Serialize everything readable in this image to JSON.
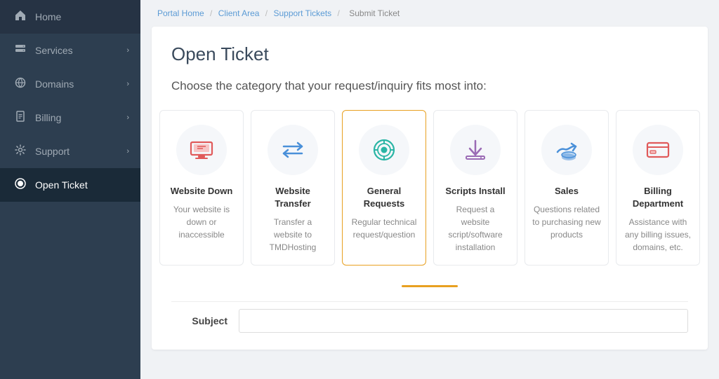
{
  "sidebar": {
    "items": [
      {
        "id": "home",
        "label": "Home",
        "icon": "home",
        "arrow": false,
        "active": false
      },
      {
        "id": "services",
        "label": "Services",
        "icon": "server",
        "arrow": true,
        "active": false
      },
      {
        "id": "domains",
        "label": "Domains",
        "icon": "globe",
        "arrow": true,
        "active": false
      },
      {
        "id": "billing",
        "label": "Billing",
        "icon": "file",
        "arrow": true,
        "active": false
      },
      {
        "id": "support",
        "label": "Support",
        "icon": "gear",
        "arrow": true,
        "active": false
      },
      {
        "id": "open-ticket",
        "label": "Open Ticket",
        "icon": "ticket",
        "arrow": false,
        "active": true
      }
    ]
  },
  "breadcrumb": {
    "items": [
      {
        "label": "Portal Home",
        "link": true
      },
      {
        "label": "Client Area",
        "link": true
      },
      {
        "label": "Support Tickets",
        "link": true
      },
      {
        "label": "Submit Ticket",
        "link": false
      }
    ]
  },
  "page": {
    "title": "Open Ticket",
    "subtitle": "Choose the category that your request/inquiry fits most into:"
  },
  "categories": [
    {
      "id": "website-down",
      "title": "Website Down",
      "description": "Your website is down or inaccessible",
      "color": "#e05a5a",
      "selected": false
    },
    {
      "id": "website-transfer",
      "title": "Website Transfer",
      "description": "Transfer a website to TMDHosting",
      "color": "#4a90d9",
      "selected": false
    },
    {
      "id": "general-requests",
      "title": "General Requests",
      "description": "Regular technical request/question",
      "color": "#2ab5a5",
      "selected": true
    },
    {
      "id": "scripts-install",
      "title": "Scripts Install",
      "description": "Request a website script/software installation",
      "color": "#9b6bb5",
      "selected": false
    },
    {
      "id": "sales",
      "title": "Sales",
      "description": "Questions related to purchasing new products",
      "color": "#4a90d9",
      "selected": false
    },
    {
      "id": "billing-department",
      "title": "Billing Department",
      "description": "Assistance with any billing issues, domains, etc.",
      "color": "#e05a5a",
      "selected": false
    }
  ],
  "subject": {
    "label": "Subject",
    "placeholder": ""
  }
}
